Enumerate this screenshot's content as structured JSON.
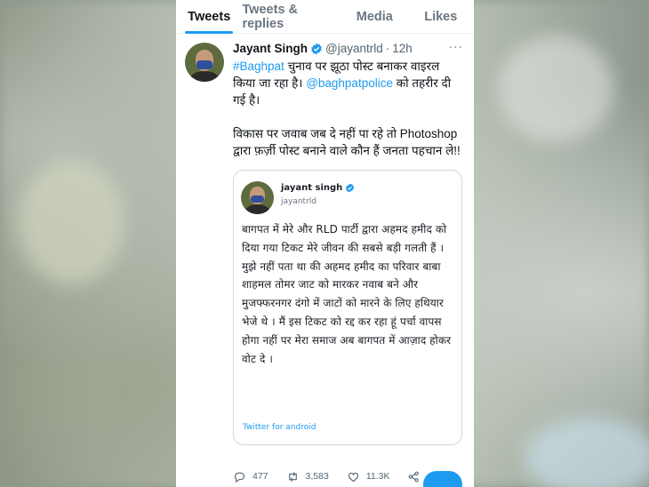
{
  "tabs": [
    "Tweets",
    "Tweets & replies",
    "Media",
    "Likes"
  ],
  "tweet": {
    "name": "Jayant Singh",
    "handle": "@jayantrld",
    "time": "12h",
    "text_line1_hashtag": "#Baghpat",
    "text_line1_rest": " चुनाव पर झूठा पोस्ट बनाकर वाइरल किया जा रहा है। ",
    "text_mention": "@baghpatpolice",
    "text_line2_rest": " को तहरीर दी गई है।",
    "text_para2": "विकास पर जवाब जब दे नहीं पा रहे तो Photoshop द्वारा फ़र्ज़ी पोस्ट बनाने वाले कौन हैं जनता पहचान ले!!"
  },
  "quoted": {
    "name": "jayant singh",
    "handle": "jayantrld",
    "text": "बागपत में मेरे और RLD पार्टी द्वारा अहमद हमीद को दिया गया टिकट मेरे जीवन की सबसे बड़ी गलती हैं । मुझे नहीं पता था की अहमद हमीद का परिवार बाबा शाहमल तोमर जाट को मारकर नवाब बने और मुजफ्फरनगर दंगो में जाटों को मारने के लिए हथियार भेजे थे । मैं इस टिकट को रद्द कर रहा हूं पर्चा वापस होगा नहीं पर मेरा समाज अब बागपत में आज़ाद होकर वोट दे ।",
    "source": "Twitter for android"
  },
  "actions": {
    "replies": "477",
    "retweets": "3,583",
    "likes": "11.3K"
  },
  "colors": {
    "accent": "#1d9bf0",
    "text": "#0f1419",
    "secondary": "#536471"
  },
  "icons": [
    "verified-badge-icon",
    "more-icon",
    "reply-icon",
    "retweet-icon",
    "like-icon",
    "share-icon",
    "compose-fab-icon"
  ]
}
